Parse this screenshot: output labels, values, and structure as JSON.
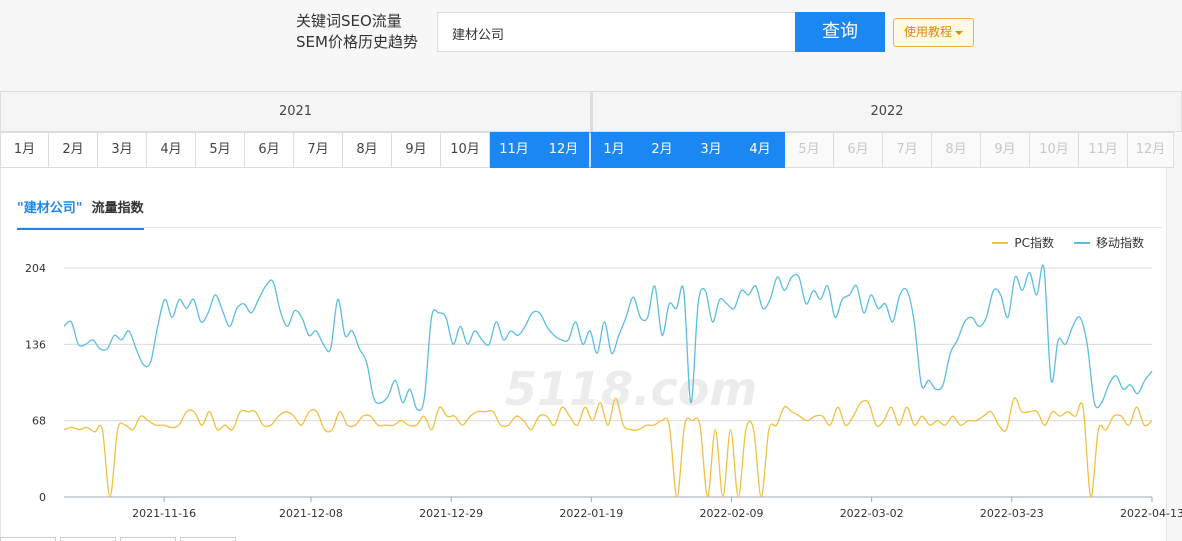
{
  "header": {
    "title_line1": "关键词SEO流量",
    "title_line2": "SEM价格历史趋势",
    "search_value": "建材公司",
    "search_button": "查询",
    "tutorial_button": "使用教程"
  },
  "years": [
    {
      "label": "2021"
    },
    {
      "label": "2022"
    }
  ],
  "months": [
    {
      "label": "1月",
      "state": "normal"
    },
    {
      "label": "2月",
      "state": "normal"
    },
    {
      "label": "3月",
      "state": "normal"
    },
    {
      "label": "4月",
      "state": "normal"
    },
    {
      "label": "5月",
      "state": "normal"
    },
    {
      "label": "6月",
      "state": "normal"
    },
    {
      "label": "7月",
      "state": "normal"
    },
    {
      "label": "8月",
      "state": "normal"
    },
    {
      "label": "9月",
      "state": "normal"
    },
    {
      "label": "10月",
      "state": "normal"
    },
    {
      "label": "11月",
      "state": "active"
    },
    {
      "label": "12月",
      "state": "active"
    },
    {
      "label": "1月",
      "state": "active"
    },
    {
      "label": "2月",
      "state": "active"
    },
    {
      "label": "3月",
      "state": "active"
    },
    {
      "label": "4月",
      "state": "active"
    },
    {
      "label": "5月",
      "state": "disabled"
    },
    {
      "label": "6月",
      "state": "disabled"
    },
    {
      "label": "7月",
      "state": "disabled"
    },
    {
      "label": "8月",
      "state": "disabled"
    },
    {
      "label": "9月",
      "state": "disabled"
    },
    {
      "label": "10月",
      "state": "disabled"
    },
    {
      "label": "11月",
      "state": "disabled"
    },
    {
      "label": "12月",
      "state": "disabled"
    }
  ],
  "panel": {
    "tab_keyword": "\"建材公司\"",
    "tab_suffix": "流量指数"
  },
  "watermark": "5118.com",
  "chart_data": {
    "type": "line",
    "x_start": "2021-11-01",
    "x_end": "2022-04-13",
    "x_ticks": [
      "2021-11-16",
      "2021-12-08",
      "2021-12-29",
      "2022-01-19",
      "2022-02-09",
      "2022-03-02",
      "2022-03-23",
      "2022-04-13"
    ],
    "y_ticks": [
      0,
      68,
      136,
      204
    ],
    "ylim": [
      0,
      204
    ],
    "grid": true,
    "legend_position": "top-right",
    "series": [
      {
        "name": "PC指数",
        "color": "#f0c040",
        "values": [
          60,
          62,
          60,
          62,
          58,
          60,
          0,
          60,
          64,
          60,
          72,
          68,
          64,
          64,
          62,
          64,
          76,
          76,
          64,
          76,
          60,
          64,
          60,
          76,
          76,
          76,
          64,
          64,
          72,
          76,
          72,
          64,
          76,
          76,
          60,
          60,
          76,
          64,
          64,
          72,
          72,
          64,
          64,
          64,
          68,
          64,
          64,
          72,
          60,
          80,
          72,
          72,
          64,
          72,
          76,
          76,
          76,
          64,
          64,
          72,
          68,
          60,
          72,
          72,
          64,
          80,
          72,
          64,
          80,
          68,
          84,
          64,
          88,
          64,
          60,
          60,
          64,
          64,
          68,
          64,
          0,
          64,
          68,
          64,
          0,
          60,
          0,
          60,
          0,
          60,
          60,
          0,
          60,
          64,
          80,
          76,
          72,
          68,
          72,
          72,
          64,
          80,
          64,
          72,
          84,
          84,
          64,
          68,
          80,
          64,
          80,
          64,
          72,
          64,
          68,
          64,
          72,
          64,
          68,
          68,
          72,
          76,
          64,
          60,
          88,
          76,
          76,
          76,
          64,
          76,
          72,
          76,
          72,
          80,
          0,
          60,
          60,
          72,
          72,
          64,
          80,
          64,
          68
        ]
      },
      {
        "name": "移动指数",
        "color": "#5bbde0",
        "values": [
          152,
          156,
          136,
          136,
          140,
          132,
          132,
          144,
          140,
          148,
          132,
          118,
          120,
          152,
          176,
          160,
          176,
          168,
          176,
          156,
          164,
          180,
          166,
          152,
          168,
          172,
          164,
          176,
          188,
          192,
          166,
          152,
          166,
          160,
          144,
          148,
          136,
          132,
          176,
          144,
          148,
          132,
          120,
          88,
          84,
          90,
          104,
          84,
          96,
          78,
          88,
          160,
          164,
          160,
          136,
          152,
          136,
          148,
          140,
          136,
          156,
          140,
          148,
          144,
          152,
          164,
          164,
          152,
          144,
          140,
          140,
          156,
          136,
          148,
          128,
          156,
          128,
          144,
          160,
          178,
          160,
          160,
          188,
          144,
          172,
          168,
          184,
          84,
          172,
          184,
          156,
          176,
          172,
          168,
          184,
          180,
          188,
          168,
          176,
          196,
          184,
          196,
          196,
          172,
          184,
          176,
          188,
          160,
          176,
          180,
          188,
          164,
          180,
          168,
          172,
          156,
          180,
          184,
          156,
          100,
          104,
          96,
          100,
          128,
          140,
          156,
          160,
          152,
          160,
          184,
          180,
          160,
          196,
          184,
          200,
          180,
          204,
          104,
          140,
          136,
          152,
          160,
          136,
          84,
          84,
          100,
          108,
          96,
          100,
          92,
          104,
          112
        ]
      }
    ]
  }
}
